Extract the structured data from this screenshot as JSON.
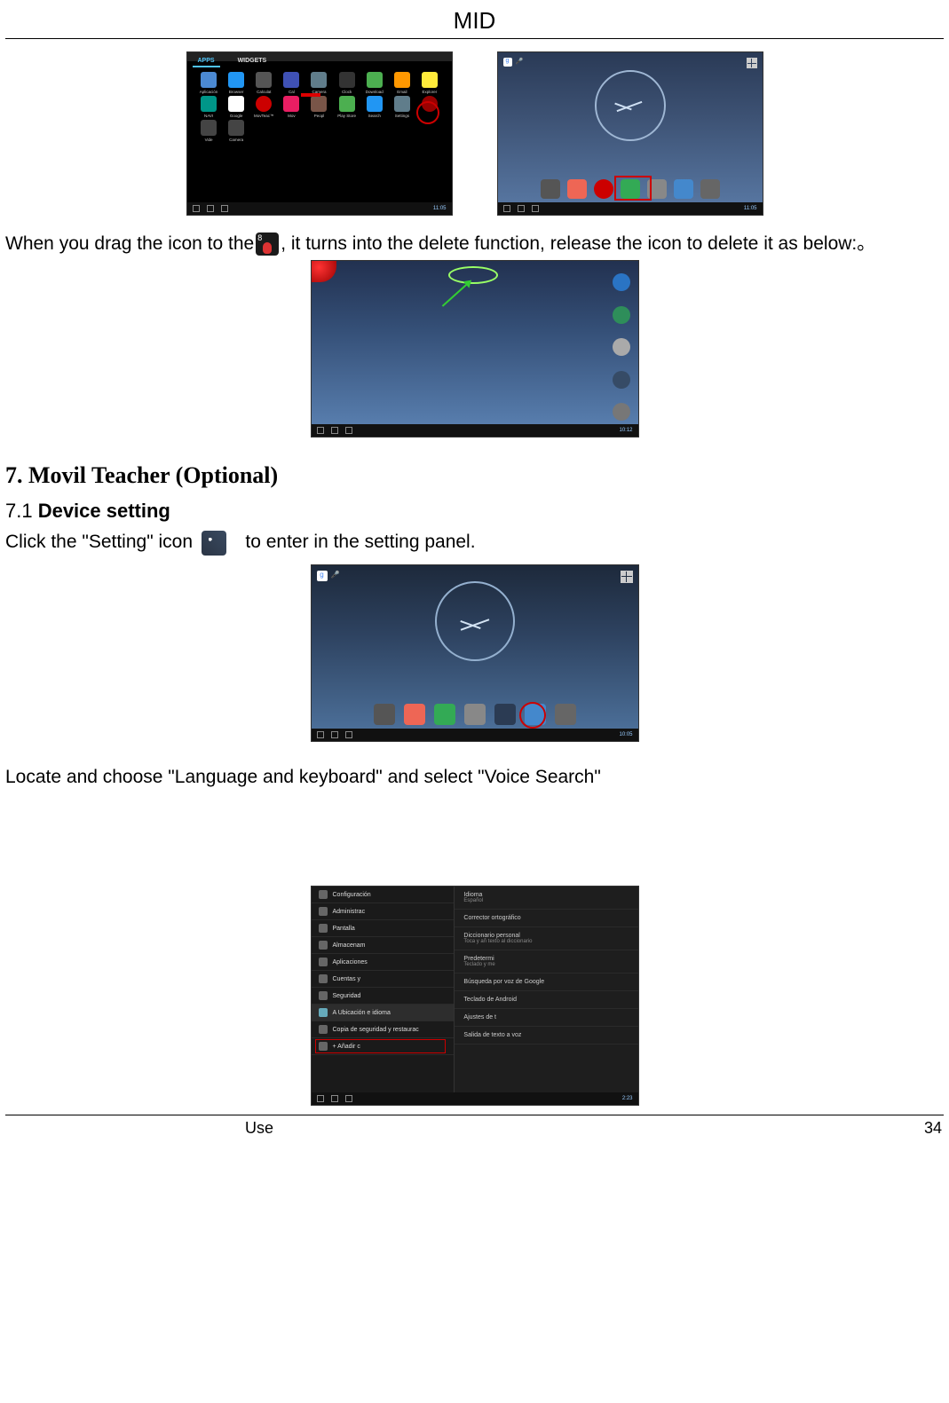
{
  "header": {
    "title": "MID"
  },
  "paragraphs": {
    "drag_delete": "When you drag the icon to the         , it turns into the delete function, release the icon to delete it as below:。",
    "setting_intro_a": "Click the \"Setting\" icon",
    "setting_intro_b": "to enter in the setting panel.",
    "lang_keyboard": "Locate and choose \"Language and keyboard\" and select \"Voice Search\""
  },
  "section": {
    "h2": "7. Movil Teacher (Optional)",
    "h3_num": "7.1 ",
    "h3_text": "Device setting"
  },
  "shot1": {
    "tabs": [
      "APPS",
      "WIDGETS"
    ],
    "apps_row1": [
      "Aplicación",
      "Browser",
      "Calculat",
      "Cal",
      "Camera",
      "Clock",
      "Download",
      "Email",
      "Explorer"
    ],
    "apps_row2": [
      "NAVI",
      "Google",
      "MovTeac™",
      "Mov",
      "Peopl",
      "Play Store",
      "Search",
      "Settings",
      ""
    ],
    "apps_row3": [
      "Vide",
      "Camera",
      "",
      "",
      "",
      "",
      "",
      "",
      ""
    ],
    "nav_time": "11:05"
  },
  "shot2": {
    "dock": [
      "Gallery",
      "Media",
      "Sound",
      "Apps",
      "Camera",
      "Files",
      "Gallery"
    ],
    "nav_time": "11:05"
  },
  "shot3": {
    "side_dock": [
      "Browser",
      "Music",
      "Camera",
      "Settings",
      "Gallery"
    ],
    "nav_time": "10:12"
  },
  "shot4": {
    "dock": [
      "Gallery",
      "Media",
      "Sound",
      "Camera",
      "Settings",
      "Files",
      "Gallery"
    ],
    "nav_time": "10:05"
  },
  "shot5": {
    "left_items": [
      "Configuración",
      "Administrac",
      "Pantalla",
      "Almacenam",
      "Aplicaciones",
      "Cuentas y",
      "Seguridad",
      "A Ubicación e idioma",
      "Copia de seguridad y restaurac",
      "+ Añadir c",
      "",
      ""
    ],
    "right_items": [
      {
        "t": "Idioma",
        "s": "Español"
      },
      {
        "t": "Corrector ortográfico",
        "s": ""
      },
      {
        "t": "Diccionario personal",
        "s": "Toca y añ texto al diccionario"
      },
      {
        "t": "Predetermi",
        "s": "Teclado y me"
      },
      {
        "t": "Búsqueda por voz de Google",
        "s": ""
      },
      {
        "t": "Teclado de Android",
        "s": ""
      },
      {
        "t": "Ajustes de t",
        "s": ""
      },
      {
        "t": "Salida de texto a voz",
        "s": ""
      }
    ],
    "nav_time": "2:23"
  },
  "footer": {
    "text": "Use",
    "page": "34"
  }
}
